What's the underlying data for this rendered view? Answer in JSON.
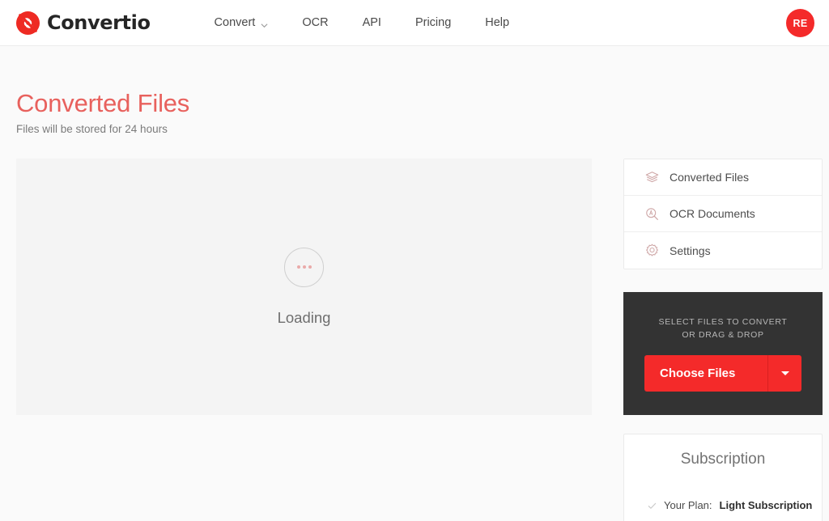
{
  "header": {
    "brand": {
      "name": "Convertio",
      "icon": "convertio-logo-icon"
    },
    "nav": [
      {
        "label": "Convert",
        "icon": "chevron-down-icon",
        "has_chevron": true
      },
      {
        "label": "OCR",
        "has_chevron": false
      },
      {
        "label": "API",
        "has_chevron": false
      },
      {
        "label": "Pricing",
        "has_chevron": false
      },
      {
        "label": "Help",
        "has_chevron": false
      }
    ],
    "avatar": {
      "initials": "RE",
      "color": "#f42a2a"
    }
  },
  "page": {
    "title": "Converted Files",
    "subtitle": "Files will be stored for 24 hours",
    "title_color": "#e8615d"
  },
  "main": {
    "loading_label": "Loading",
    "spinner_icon": "loading-dots-icon"
  },
  "sidebar": {
    "menu": [
      {
        "label": "Converted Files",
        "icon": "layers-icon"
      },
      {
        "label": "OCR Documents",
        "icon": "ocr-magnifier-icon"
      },
      {
        "label": "Settings",
        "icon": "gear-icon"
      }
    ]
  },
  "upload": {
    "hint_line1": "SELECT FILES TO CONVERT",
    "hint_line2": "OR DRAG & DROP",
    "button_label": "Choose Files",
    "dropdown_icon": "caret-down-icon",
    "button_color": "#f42a2a",
    "panel_color": "#333333"
  },
  "subscription": {
    "title": "Subscription",
    "check_icon": "check-icon",
    "plan_prefix": "Your Plan:",
    "plan_name": "Light Subscription"
  }
}
